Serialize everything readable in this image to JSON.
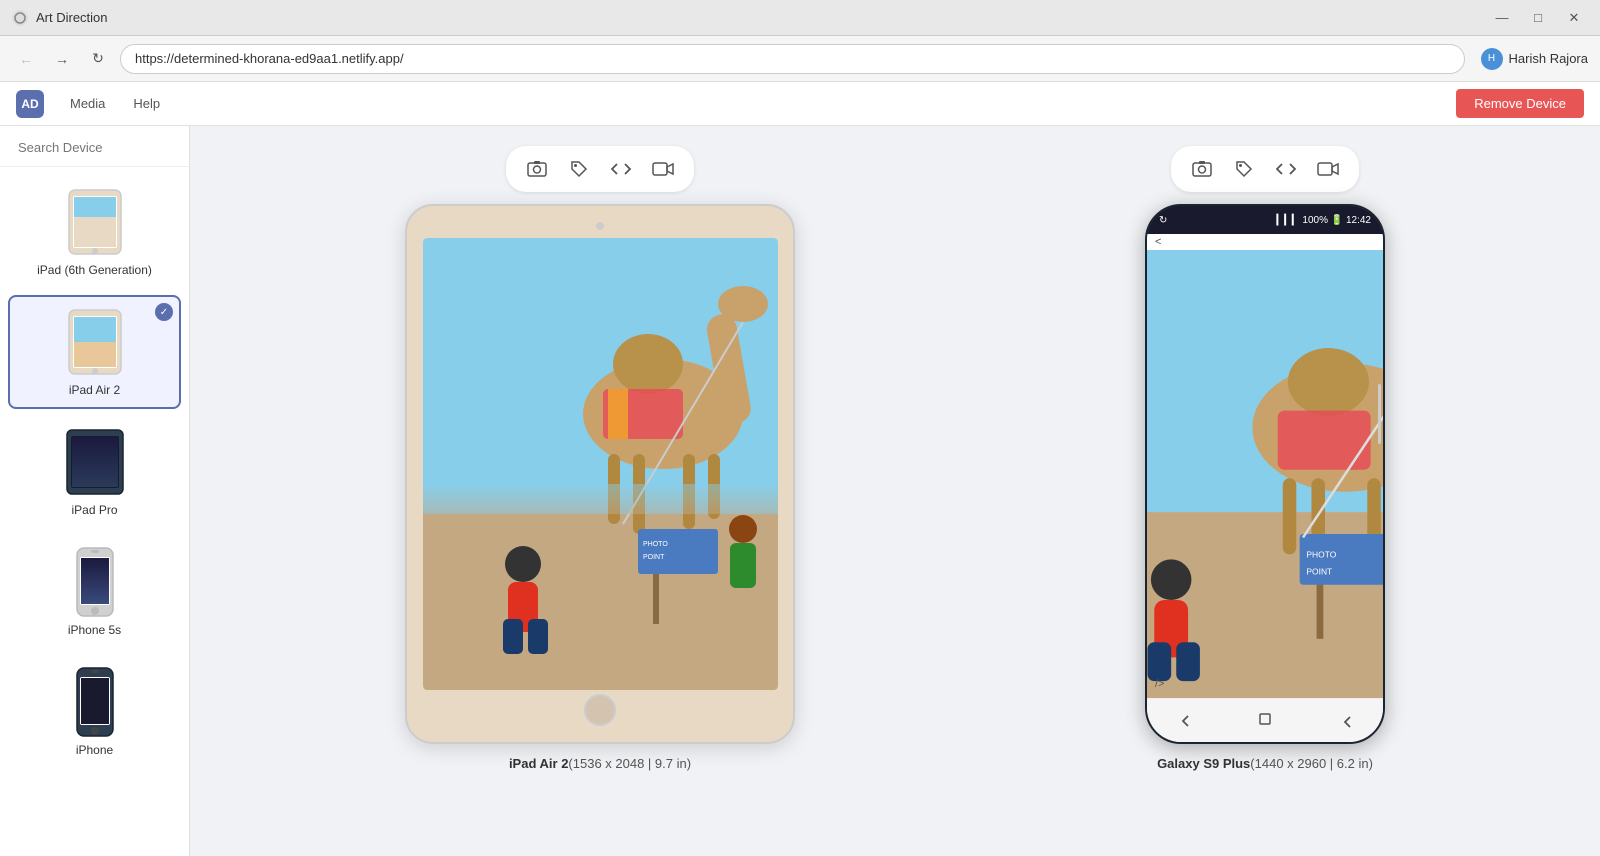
{
  "titleBar": {
    "icon": "⊙",
    "title": "Art Direction",
    "minimizeLabel": "—",
    "maximizeLabel": "□",
    "closeLabel": "✕"
  },
  "browserToolbar": {
    "backLabel": "←",
    "forwardLabel": "→",
    "reloadLabel": "↺",
    "url": "https://determined-khorana-ed9aa1.netlify.app/",
    "userAvatar": "H",
    "userName": "Harish Rajora"
  },
  "appHeader": {
    "logoLabel": "AD",
    "navItems": [
      "Media",
      "Help"
    ],
    "removeDeviceLabel": "Remove Device"
  },
  "sidebar": {
    "searchPlaceholder": "Search Device",
    "collapseLabel": "«",
    "devices": [
      {
        "id": "ipad-6th",
        "name": "iPad (6th Generation)",
        "selected": false,
        "hasCheck": false
      },
      {
        "id": "ipad-air-2",
        "name": "iPad Air 2",
        "selected": true,
        "hasCheck": true
      },
      {
        "id": "ipad-pro",
        "name": "iPad Pro",
        "selected": false,
        "hasCheck": false
      },
      {
        "id": "iphone-5s",
        "name": "iPhone 5s",
        "selected": false,
        "hasCheck": false
      },
      {
        "id": "iphone-extra",
        "name": "iPhone",
        "selected": false,
        "hasCheck": false
      }
    ]
  },
  "devices": [
    {
      "id": "ipad-air-2-main",
      "type": "tablet",
      "label": "iPad Air 2",
      "specs": "(1536 x 2048 | 9.7 in)"
    },
    {
      "id": "galaxy-s9-plus-main",
      "type": "phone",
      "label": "Galaxy S9 Plus",
      "specs": "(1440 x 2960 | 6.2 in)"
    }
  ],
  "galaxyStatus": {
    "loading": "↻",
    "signal": "▎▎▎",
    "battery": "100% 🔋",
    "time": "12:42",
    "back": "<"
  },
  "toolbar": {
    "screenshotIcon": "📷",
    "tagIcon": "◇",
    "codeIcon": "<>",
    "videoIcon": "📹"
  },
  "colors": {
    "accent": "#5b6eae",
    "removeBtn": "#e85555",
    "selectedBorder": "#5b6eae",
    "galaxyBg": "#2c3e50"
  }
}
